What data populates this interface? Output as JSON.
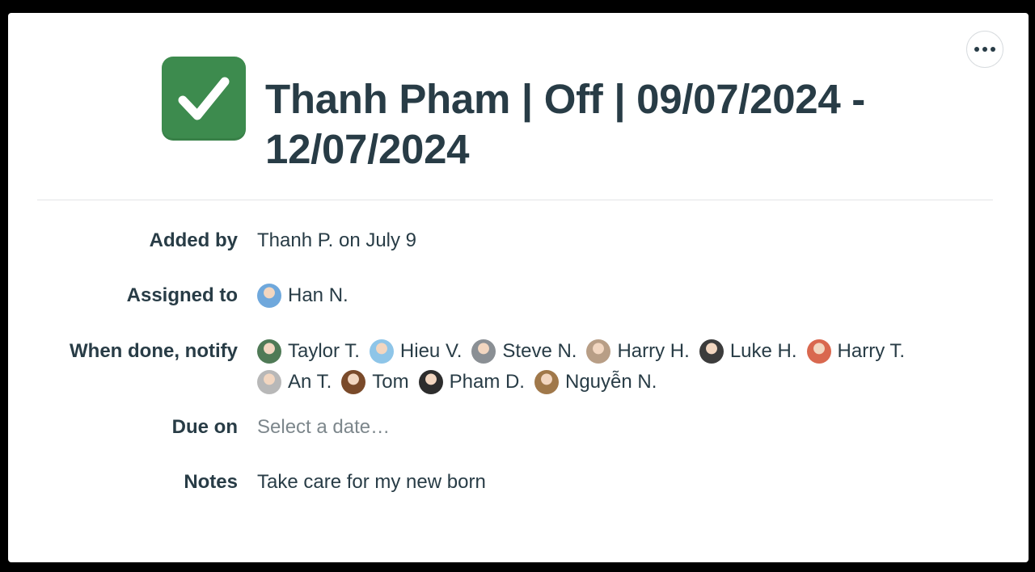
{
  "todo": {
    "title": "Thanh Pham | Off | 09/07/2024 - 12/07/2024",
    "completed": true,
    "status_color": "#3d8b4e"
  },
  "fields": {
    "added_by": {
      "label": "Added by",
      "value": "Thanh P. on July 9"
    },
    "assigned_to": {
      "label": "Assigned to",
      "people": [
        {
          "name": "Han N.",
          "avatar": "cartoon-avatar",
          "color": "#6fa8dc"
        }
      ]
    },
    "notify": {
      "label": "When done, notify",
      "people": [
        {
          "name": "Taylor T.",
          "avatar": "photo-avatar",
          "color": "#4f7a56"
        },
        {
          "name": "Hieu V.",
          "avatar": "sky-avatar",
          "color": "#8ec5e8"
        },
        {
          "name": "Steve N.",
          "avatar": "photo-avatar",
          "color": "#8a8f94"
        },
        {
          "name": "Harry H.",
          "avatar": "photo-avatar",
          "color": "#b89e86"
        },
        {
          "name": "Luke H.",
          "avatar": "photo-avatar",
          "color": "#3c3c3c"
        },
        {
          "name": "Harry T.",
          "avatar": "cartoon-avatar",
          "color": "#d9684f"
        },
        {
          "name": "An T.",
          "avatar": "photo-avatar",
          "color": "#b8b8b8"
        },
        {
          "name": "Tom",
          "avatar": "photo-avatar",
          "color": "#7a4a2a"
        },
        {
          "name": "Pham D.",
          "avatar": "photo-avatar",
          "color": "#2d2d2d"
        },
        {
          "name": "Nguyễn N.",
          "avatar": "photo-avatar",
          "color": "#a0784a"
        }
      ]
    },
    "due_on": {
      "label": "Due on",
      "placeholder": "Select a date…"
    },
    "notes": {
      "label": "Notes",
      "value": "Take care for my new born"
    }
  },
  "menu": {
    "icon": "more-options-icon"
  }
}
